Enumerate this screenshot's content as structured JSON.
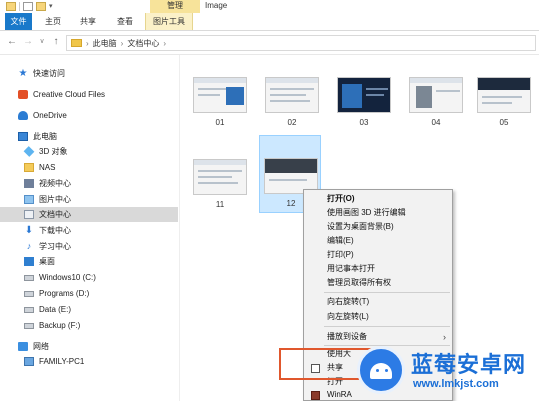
{
  "titlebar": {
    "manage_tab": "管理",
    "window_title": "Image"
  },
  "ribbon": {
    "tabs": [
      "文件",
      "主页",
      "共享",
      "查看",
      "图片工具"
    ]
  },
  "address": {
    "path": [
      "此电脑",
      "文档中心"
    ]
  },
  "sidebar": {
    "items": [
      {
        "label": "快速访问",
        "icon": "star-icon"
      },
      {
        "label": "Creative Cloud Files",
        "icon": "creative-cloud-icon"
      },
      {
        "label": "OneDrive",
        "icon": "onedrive-icon"
      },
      {
        "label": "此电脑",
        "icon": "this-pc-icon"
      },
      {
        "label": "3D 对象",
        "icon": "3d-objects-icon"
      },
      {
        "label": "NAS",
        "icon": "folder-icon"
      },
      {
        "label": "视频中心",
        "icon": "video-icon"
      },
      {
        "label": "图片中心",
        "icon": "pictures-icon"
      },
      {
        "label": "文档中心",
        "icon": "documents-icon",
        "selected": true
      },
      {
        "label": "下载中心",
        "icon": "download-icon"
      },
      {
        "label": "学习中心",
        "icon": "music-icon"
      },
      {
        "label": "桌面",
        "icon": "desktop-icon"
      },
      {
        "label": "Windows10 (C:)",
        "icon": "drive-icon"
      },
      {
        "label": "Programs (D:)",
        "icon": "drive-icon"
      },
      {
        "label": "Data (E:)",
        "icon": "drive-icon"
      },
      {
        "label": "Backup (F:)",
        "icon": "drive-icon"
      },
      {
        "label": "网络",
        "icon": "network-icon"
      },
      {
        "label": "FAMILY-PC1",
        "icon": "computer-icon"
      }
    ]
  },
  "files": [
    {
      "name": "01"
    },
    {
      "name": "02"
    },
    {
      "name": "03"
    },
    {
      "name": "04"
    },
    {
      "name": "05"
    },
    {
      "name": "11"
    },
    {
      "name": "12",
      "selected": true
    }
  ],
  "context_menu": {
    "items": [
      "打开(O)",
      "使用画图 3D 进行编辑",
      "设置为桌面背景(B)",
      "编辑(E)",
      "打印(P)",
      "用记事本打开",
      "管理员取得所有权",
      "向右旋转(T)",
      "向左旋转(L)",
      "播放到设备",
      "使用大",
      "共享",
      "打开",
      "WinRA"
    ]
  },
  "watermark": {
    "title": "蓝莓安卓网",
    "url": "www.lmkjst.com"
  },
  "colors": {
    "file_tab": "#1979ca",
    "selection": "#cce8ff",
    "highlight_box": "#e0572d",
    "watermark": "#1b6fd6"
  }
}
